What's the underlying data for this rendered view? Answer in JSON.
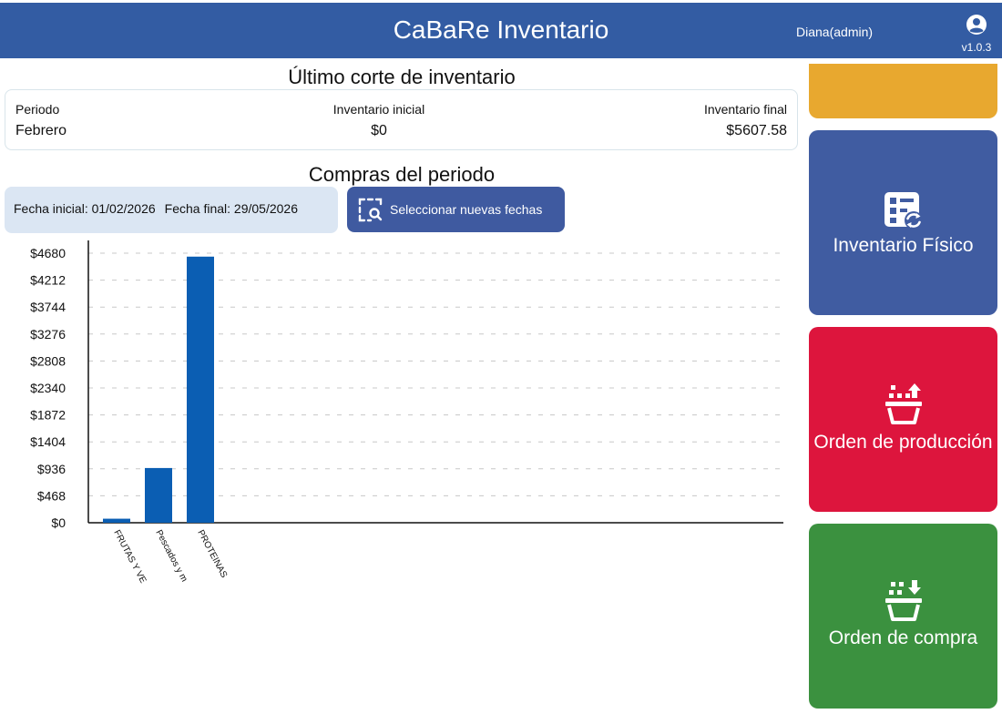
{
  "header": {
    "title": "CaBaRe Inventario",
    "user": "Diana(admin)",
    "version": "v1.0.3",
    "account_icon": "account-circle-icon"
  },
  "last_cut": {
    "title": "Último corte de inventario",
    "period_label": "Periodo",
    "period_value": "Febrero",
    "initial_label": "Inventario inicial",
    "initial_value": "$0",
    "final_label": "Inventario final",
    "final_value": "$5607.58"
  },
  "purchases": {
    "title": "Compras del periodo",
    "start_date": "Fecha inicial: 01/02/2026",
    "end_date": "Fecha final: 29/05/2026",
    "select_button": "Seleccionar nuevas fechas",
    "select_icon": "calendar-search-icon"
  },
  "chart_data": {
    "type": "bar",
    "categories": [
      "FRUTAS Y VE",
      "Pescados y m",
      "PROTEINAS"
    ],
    "values": [
      70,
      950,
      4620
    ],
    "ylim": [
      0,
      4680
    ],
    "yticks": [
      "$0",
      "$468",
      "$936",
      "$1404",
      "$1872",
      "$2340",
      "$2808",
      "$3276",
      "$3744",
      "$4212",
      "$4680"
    ],
    "grid": true,
    "bar_color": "#0b5eb3"
  },
  "tiles": [
    {
      "label": "",
      "color": "#e8a82f"
    },
    {
      "label": "Inventario Físico",
      "color": "#405ca1",
      "icon": "inventory-sync-icon"
    },
    {
      "label": "Orden de producción",
      "color": "#dd153d",
      "icon": "basket-upload-icon"
    },
    {
      "label": "Orden de compra",
      "color": "#3b913f",
      "icon": "basket-download-icon"
    }
  ]
}
